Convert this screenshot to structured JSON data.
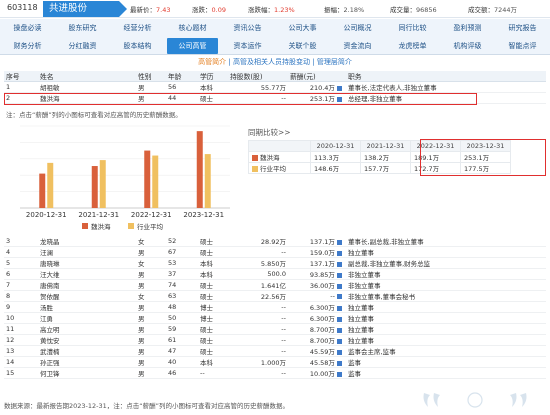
{
  "header": {
    "code": "603118",
    "name": "共进股份",
    "quotes": [
      {
        "k": "最新价：",
        "v": "7.43"
      },
      {
        "k": "涨跌：",
        "v": "0.09"
      },
      {
        "k": "涨跌幅：",
        "v": "1.23%"
      },
      {
        "k": "振幅：",
        "v": "2.18%",
        "plain": true
      },
      {
        "k": "成交量：",
        "v": "96856",
        "plain": true
      },
      {
        "k": "成交额：",
        "v": "7244万",
        "plain": true
      }
    ]
  },
  "nav": {
    "row1": [
      "操盘必读",
      "股东研究",
      "经营分析",
      "核心题材",
      "资讯公告",
      "公司大事",
      "公司概况",
      "同行比较",
      "盈利预测",
      "研究报告"
    ],
    "row2": [
      "财务分析",
      "分红融资",
      "股本结构",
      "公司高管",
      "资本运作",
      "关联个股",
      "资金流向",
      "龙虎榜单",
      "机构评级",
      "智能点评"
    ],
    "active_row2_index": 3
  },
  "subtabs": {
    "items": [
      "高管简介",
      "高管及相关人员持股变动",
      "管理层简介"
    ],
    "sep": "|",
    "active_index": 0
  },
  "table": {
    "headers": [
      "序号",
      "姓名",
      "性别",
      "年龄",
      "学历",
      "持股数(股)",
      "薪酬(元)",
      "职务"
    ],
    "rows_top": [
      [
        "1",
        "胡祖敏",
        "男",
        "56",
        "本科",
        "55.77万",
        "210.4万",
        "董事长,法定代表人,非独立董事"
      ],
      [
        "2",
        "魏洪海",
        "男",
        "44",
        "硕士",
        "--",
        "253.1万",
        "总经理,非独立董事"
      ]
    ],
    "rows_bottom": [
      [
        "3",
        "龙晓晶",
        "女",
        "52",
        "硕士",
        "28.92万",
        "137.1万",
        "董事长,副总裁,非独立董事"
      ],
      [
        "4",
        "汪澜",
        "男",
        "67",
        "硕士",
        "--",
        "159.0万",
        "独立董事"
      ],
      [
        "5",
        "唐晓琳",
        "女",
        "53",
        "本科",
        "5.850万",
        "137.1万",
        "副总裁,非独立董事,财务总监"
      ],
      [
        "6",
        "汪大维",
        "男",
        "37",
        "本科",
        "500.0",
        "93.85万",
        "非独立董事"
      ],
      [
        "7",
        "唐佛南",
        "男",
        "74",
        "硕士",
        "1.641亿",
        "36.00万",
        "非独立董事"
      ],
      [
        "8",
        "贺依醒",
        "女",
        "63",
        "硕士",
        "22.56万",
        "--",
        "非独立董事,董事会秘书"
      ],
      [
        "9",
        "汤胜",
        "男",
        "48",
        "博士",
        "--",
        "6.300万",
        "独立董事"
      ],
      [
        "10",
        "江勇",
        "男",
        "50",
        "博士",
        "--",
        "6.300万",
        "独立董事"
      ],
      [
        "11",
        "高立明",
        "男",
        "59",
        "硕士",
        "--",
        "8.700万",
        "独立董事"
      ],
      [
        "12",
        "黄忱安",
        "男",
        "61",
        "硕士",
        "--",
        "8.700万",
        "独立董事"
      ],
      [
        "13",
        "武澧楠",
        "男",
        "47",
        "硕士",
        "--",
        "45.59万",
        "监事会主席,监事"
      ],
      [
        "14",
        "孙正强",
        "男",
        "40",
        "本科",
        "1.000万",
        "45.58万",
        "监事"
      ],
      [
        "15",
        "何卫锋",
        "男",
        "46",
        "--",
        "--",
        "10.00万",
        "监事"
      ]
    ]
  },
  "note_text": "注：点击“薪酬”列的小图标可查看对应高管的历史薪酬数据。",
  "compare": {
    "title": "同期比较>>",
    "headers": [
      "",
      "2020-12-31",
      "2021-12-31",
      "2022-12-31",
      "2023-12-31"
    ],
    "rows": [
      {
        "label": "魏洪海",
        "color": "#d9603b",
        "values": [
          "113.3万",
          "138.2万",
          "189.1万",
          "253.1万"
        ]
      },
      {
        "label": "行业平均",
        "color": "#f0c060",
        "values": [
          "148.6万",
          "157.7万",
          "172.7万",
          "177.5万"
        ]
      }
    ]
  },
  "chart_data": {
    "type": "bar",
    "categories": [
      "2020-12-31",
      "2021-12-31",
      "2022-12-31",
      "2023-12-31"
    ],
    "series": [
      {
        "name": "魏洪海",
        "color": "#d9603b",
        "values": [
          113.3,
          138.2,
          189.1,
          253.1
        ]
      },
      {
        "name": "行业平均",
        "color": "#f0c060",
        "values": [
          148.6,
          157.7,
          172.7,
          177.5
        ]
      }
    ],
    "ylim": [
      0,
      270
    ],
    "legend": "bottom"
  },
  "footer": {
    "text": "数据来源：最新报告期2023-12-31，注：点击“薪酬”列的小图标可查看对应高管的历史薪酬数据。"
  }
}
